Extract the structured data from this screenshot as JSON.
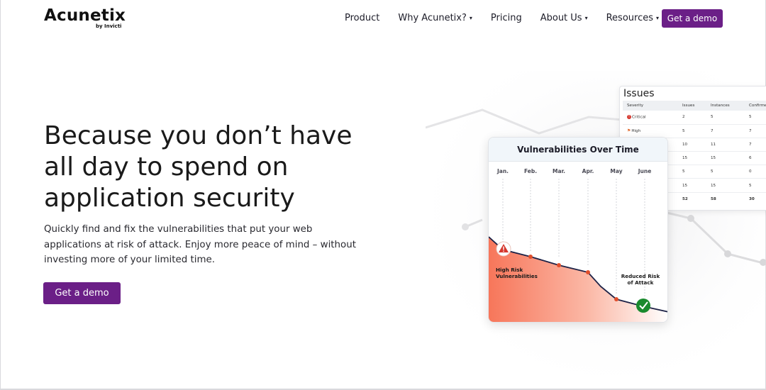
{
  "brand": {
    "name": "Acunetix",
    "tagline": "by Invicti"
  },
  "nav": {
    "items": [
      {
        "label": "Product",
        "dropdown": false
      },
      {
        "label": "Why Acunetix?",
        "dropdown": true
      },
      {
        "label": "Pricing",
        "dropdown": false
      },
      {
        "label": "About Us",
        "dropdown": true
      },
      {
        "label": "Resources",
        "dropdown": true
      }
    ],
    "cta_label": "Get a demo"
  },
  "hero": {
    "headline": "Because you don’t have all day to spend on application security",
    "subtext": "Quickly find and fix the vulnerabilities that put your web applications at risk of attack. Enjoy more peace of mind – without investing more of your limited time.",
    "cta_label": "Get a demo"
  },
  "issues_card": {
    "title": "Issues",
    "columns": [
      "Severity",
      "Issues",
      "Instances",
      "Confirme"
    ],
    "rows": [
      {
        "severity": "Critical",
        "icon": "critical-icon",
        "issues": "2",
        "instances": "5",
        "confirmed": "5"
      },
      {
        "severity": "High",
        "icon": "flag-icon",
        "issues": "5",
        "instances": "7",
        "confirmed": "7"
      },
      {
        "severity": "",
        "icon": "",
        "issues": "10",
        "instances": "11",
        "confirmed": "7"
      },
      {
        "severity": "",
        "icon": "",
        "issues": "15",
        "instances": "15",
        "confirmed": "6"
      },
      {
        "severity": "",
        "icon": "",
        "issues": "5",
        "instances": "5",
        "confirmed": "0"
      },
      {
        "severity": "",
        "icon": "",
        "issues": "15",
        "instances": "15",
        "confirmed": "5"
      }
    ],
    "totals": {
      "issues": "52",
      "instances": "58",
      "confirmed": "30"
    }
  },
  "vuln_card": {
    "title": "Vulnerabilities Over Time",
    "months": [
      "Jan.",
      "Feb.",
      "Mar.",
      "Apr.",
      "May",
      "June"
    ],
    "high_risk_label": "High Risk Vulnerabilities",
    "reduced_risk_label": "Reduced Risk of Attack",
    "warning_icon": "warning-icon",
    "check_icon": "check-icon"
  },
  "colors": {
    "brand_purple": "#6b1f87",
    "line": "#1e2347",
    "point": "#e04e2c",
    "area_top": "#f7765a",
    "check_green": "#1a8a2e"
  }
}
